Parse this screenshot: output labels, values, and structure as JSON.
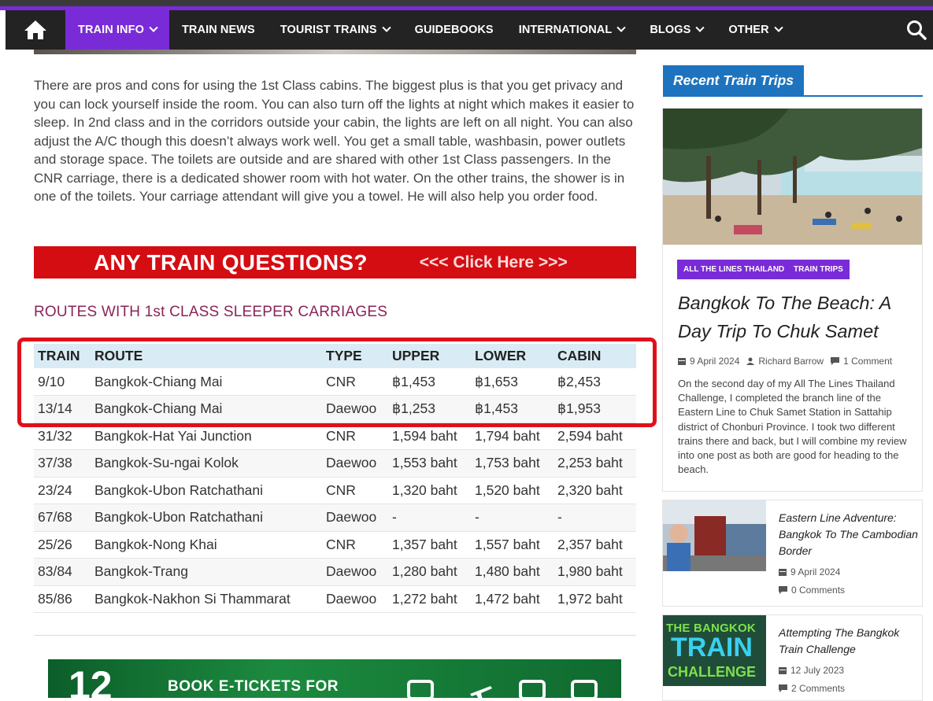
{
  "colors": {
    "nav_bg": "#232323",
    "accent": "#7a2bd8",
    "banner": "#d40d12",
    "header_blue": "#1e73be",
    "highlight": "#e0101b",
    "section_heading": "#8b2458"
  },
  "nav": {
    "home_icon": "home-icon",
    "items": [
      {
        "label": "TRAIN INFO",
        "dropdown": true,
        "active": true
      },
      {
        "label": "TRAIN NEWS",
        "dropdown": false
      },
      {
        "label": "TOURIST TRAINS",
        "dropdown": true
      },
      {
        "label": "GUIDEBOOKS",
        "dropdown": false
      },
      {
        "label": "INTERNATIONAL",
        "dropdown": true
      },
      {
        "label": "BLOGS",
        "dropdown": true
      },
      {
        "label": "OTHER",
        "dropdown": true
      }
    ],
    "search_icon": "search-icon"
  },
  "article": {
    "paragraph": "There are pros and cons for using the 1st Class cabins. The biggest plus is that you get privacy and you can lock yourself inside the room. You can also turn off the lights at night which makes it easier to sleep. In 2nd class and in the corridors outside your cabin, the lights are left on all night. You can also adjust the A/C though this doesn’t always work well. You get a small table, washbasin, power outlets and storage space. The toilets are outside and are shared with other 1st Class passengers. In the CNR carriage, there is a dedicated shower room with hot water. On the other trains, the shower is in one of the toilets. Your carriage attendant will give you a towel. He will also help you order food.",
    "banner_main": "ANY TRAIN QUESTIONS?",
    "banner_link": "<<< Click Here >>>",
    "section_heading": "ROUTES WITH 1st CLASS SLEEPER CARRIAGES",
    "table": {
      "headers": [
        "TRAIN",
        "ROUTE",
        "TYPE",
        "UPPER",
        "LOWER",
        "CABIN"
      ],
      "rows": [
        [
          "9/10",
          "Bangkok-Chiang Mai",
          "CNR",
          "฿1,453",
          "฿1,653",
          "฿2,453"
        ],
        [
          "13/14",
          "Bangkok-Chiang Mai",
          "Daewoo",
          "฿1,253",
          "฿1,453",
          "฿1,953"
        ],
        [
          "31/32",
          "Bangkok-Hat Yai Junction",
          "CNR",
          "1,594 baht",
          "1,794 baht",
          "2,594 baht"
        ],
        [
          "37/38",
          "Bangkok-Su-ngai Kolok",
          "Daewoo",
          "1,553 baht",
          "1,753 baht",
          "2,253 baht"
        ],
        [
          "23/24",
          "Bangkok-Ubon Ratchathani",
          "CNR",
          "1,320 baht",
          "1,520 baht",
          "2,320 baht"
        ],
        [
          "67/68",
          "Bangkok-Ubon Ratchathani",
          "Daewoo",
          "-",
          "-",
          "-"
        ],
        [
          "25/26",
          "Bangkok-Nong Khai",
          "CNR",
          "1,357 baht",
          "1,557 baht",
          "2,357 baht"
        ],
        [
          "83/84",
          "Bangkok-Trang",
          "Daewoo",
          "1,280 baht",
          "1,480 baht",
          "1,980 baht"
        ],
        [
          "85/86",
          "Bangkok-Nakhon Si Thammarat",
          "Daewoo",
          "1,272 baht",
          "1,472 baht",
          "1,972 baht"
        ]
      ]
    },
    "ad_text": "BOOK E-TICKETS FOR",
    "ad_number": "12"
  },
  "sidebar": {
    "heading": "Recent Train Trips",
    "featured": {
      "tags": [
        "ALL THE LINES THAILAND",
        "TRAIN TRIPS"
      ],
      "title": "Bangkok To The Beach: A Day Trip To Chuk Samet",
      "date": "9 April 2024",
      "author": "Richard Barrow",
      "comments": "1 Comment",
      "excerpt": "On the second day of my All The Lines Thailand Challenge, I completed the branch line of the Eastern Line to Chuk Samet Station in Sattahip district of Chonburi Province. I took two different trains there and back, but I will combine my review into one post as both are good for heading to the beach."
    },
    "posts": [
      {
        "title": "Eastern Line Adventure: Bangkok To The Cambodian Border",
        "date": "9 April 2024",
        "comments": "0 Comments"
      },
      {
        "title": "Attempting The Bangkok Train Challenge",
        "date": "12 July 2023",
        "comments": "2 Comments",
        "thumb_text": [
          "THE BANGKOK",
          "TRAIN",
          "CHALLENGE"
        ]
      }
    ]
  }
}
